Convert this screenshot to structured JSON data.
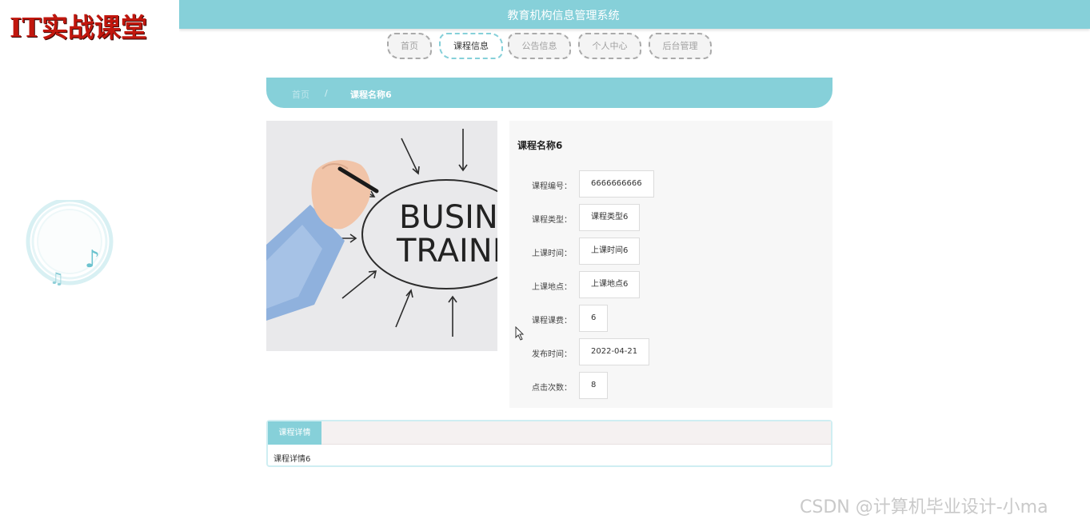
{
  "logo": {
    "text": "IT实战课堂"
  },
  "header": {
    "title": "教育机构信息管理系统"
  },
  "nav": {
    "tabs": [
      {
        "label": "首页",
        "active": false
      },
      {
        "label": "课程信息",
        "active": true
      },
      {
        "label": "公告信息",
        "active": false
      },
      {
        "label": "个人中心",
        "active": false
      },
      {
        "label": "后台管理",
        "active": false
      }
    ]
  },
  "breadcrumb": {
    "home": "首页",
    "separator": "/",
    "current": "课程名称6"
  },
  "course": {
    "image_text": [
      "BUSINES",
      "TRAININ"
    ],
    "name": "课程名称6",
    "fields": [
      {
        "label": "课程编号：",
        "value": "6666666666"
      },
      {
        "label": "课程类型：",
        "value": "课程类型6"
      },
      {
        "label": "上课时间：",
        "value": "上课时间6"
      },
      {
        "label": "上课地点：",
        "value": "上课地点6"
      },
      {
        "label": "课程课费：",
        "value": "6"
      },
      {
        "label": "发布时间：",
        "value": "2022-04-21"
      },
      {
        "label": "点击次数：",
        "value": "8"
      }
    ]
  },
  "details": {
    "tab": "课程详情",
    "content": "课程详情6"
  },
  "watermark": "CSDN @计算机毕业设计-小ma",
  "colors": {
    "accent": "#86d0d9",
    "logo_red": "#c1170e",
    "panel_bg": "#f7f7f7"
  }
}
